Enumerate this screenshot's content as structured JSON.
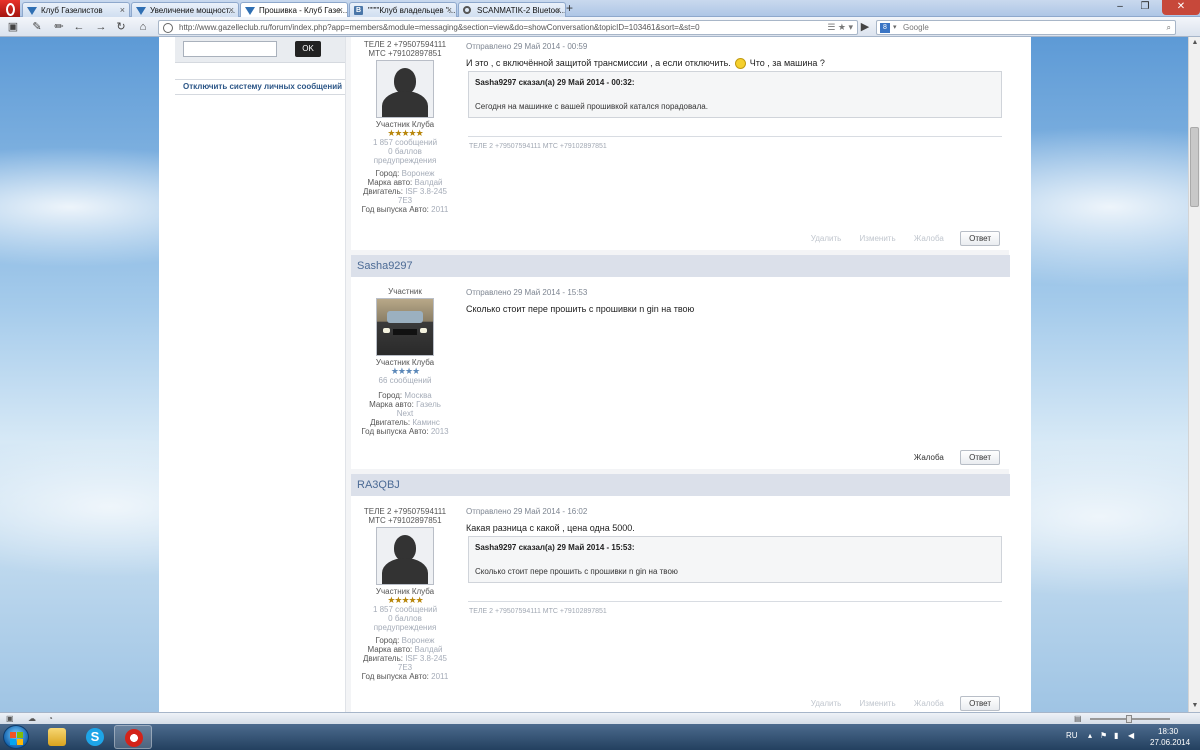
{
  "browser": {
    "tabs": [
      {
        "label": "Клуб Газелистов",
        "icon": "forum-triangle-icon"
      },
      {
        "label": "Увеличение мощност...",
        "icon": "forum-triangle-icon"
      },
      {
        "label": "Прошивка - Клуб Газе...",
        "icon": "forum-triangle-icon"
      },
      {
        "label": "\"\"\"\"Клуб владельцев \"...",
        "icon": "vk-icon"
      },
      {
        "label": "SCANMATIK-2 Bluetoo...",
        "icon": "scan-icon"
      }
    ],
    "new_tab": "+",
    "url": "http://www.gazelleclub.ru/forum/index.php?app=members&module=messaging&section=view&do=showConversation&topicID=103461&sort=&st=0",
    "search_placeholder": "Google",
    "search_engine_letter": "8"
  },
  "sidebar": {
    "ok_button": "OK",
    "disable_pm_link": "Отключить систему личных сообщений"
  },
  "posts": [
    {
      "author_name": "",
      "author_title": "ТЕЛЕ 2 +79507594111 МТС +79102897851",
      "group": "Участник Клуба",
      "stars": "★★★★★",
      "messages": "1 857 сообщений",
      "warnings": "0 баллов предупреждения",
      "city_label": "Город:",
      "city": "Воронеж",
      "car_label": "Марка авто:",
      "car": "Валдай",
      "engine_label": "Двигатель:",
      "engine": "ISF 3.8-245 7E3",
      "year_label": "Год выпуска Авто:",
      "year": "2011",
      "date": "Отправлено 29 Май 2014 - 00:59",
      "text_a": "И это , с включённой защитой трансмиссии , а если отключить.",
      "text_b": "Что , за машина ?",
      "quote_header": "Sasha9297 сказал(а) 29 Май 2014 - 00:32:",
      "quote_body": "Сегодня на машинке с вашей прошивкой катался порадовала.",
      "signature": "ТЕЛЕ 2 +79507594111 МТС +79102897851",
      "actions": {
        "delete": "Удалить",
        "edit": "Изменить",
        "report": "Жалоба",
        "reply": "Ответ"
      }
    },
    {
      "author_name": "Sasha9297",
      "author_title": "Участник",
      "group": "Участник Клуба",
      "stars": "★★★★",
      "messages": "66 сообщений",
      "city_label": "Город:",
      "city": "Москва",
      "car_label": "Марка авто:",
      "car": "Газель Next",
      "engine_label": "Двигатель:",
      "engine": "Каминс",
      "year_label": "Год выпуска Авто:",
      "year": "2013",
      "date": "Отправлено 29 Май 2014 - 15:53",
      "text": "Сколько стоит пере прошить с прошивки n gin на твою",
      "actions": {
        "report": "Жалоба",
        "reply": "Ответ"
      }
    },
    {
      "author_name": "RA3QBJ",
      "author_title": "ТЕЛЕ 2 +79507594111 МТС +79102897851",
      "group": "Участник Клуба",
      "stars": "★★★★★",
      "messages": "1 857 сообщений",
      "warnings": "0 баллов предупреждения",
      "city_label": "Город:",
      "city": "Воронеж",
      "car_label": "Марка авто:",
      "car": "Валдай",
      "engine_label": "Двигатель:",
      "engine": "ISF 3.8-245 7E3",
      "year_label": "Год выпуска Авто:",
      "year": "2011",
      "date": "Отправлено 29 Май 2014 - 16:02",
      "text": "Какая разница с какой , цена одна 5000.",
      "quote_header": "Sasha9297 сказал(а) 29 Май 2014 - 15:53:",
      "quote_body": "Сколько стоит пере прошить с прошивки n gin на твою",
      "signature": "ТЕЛЕ 2 +79507594111 МТС +79102897851",
      "actions": {
        "delete": "Удалить",
        "edit": "Изменить",
        "report": "Жалоба",
        "reply": "Ответ"
      }
    }
  ],
  "taskbar": {
    "language": "RU",
    "time": "18:30",
    "date": "27.06.2014"
  },
  "colors": {
    "post_header_bg": "#dbe0ea",
    "link_blue": "#2c5687",
    "close_button": "#c7483a"
  }
}
